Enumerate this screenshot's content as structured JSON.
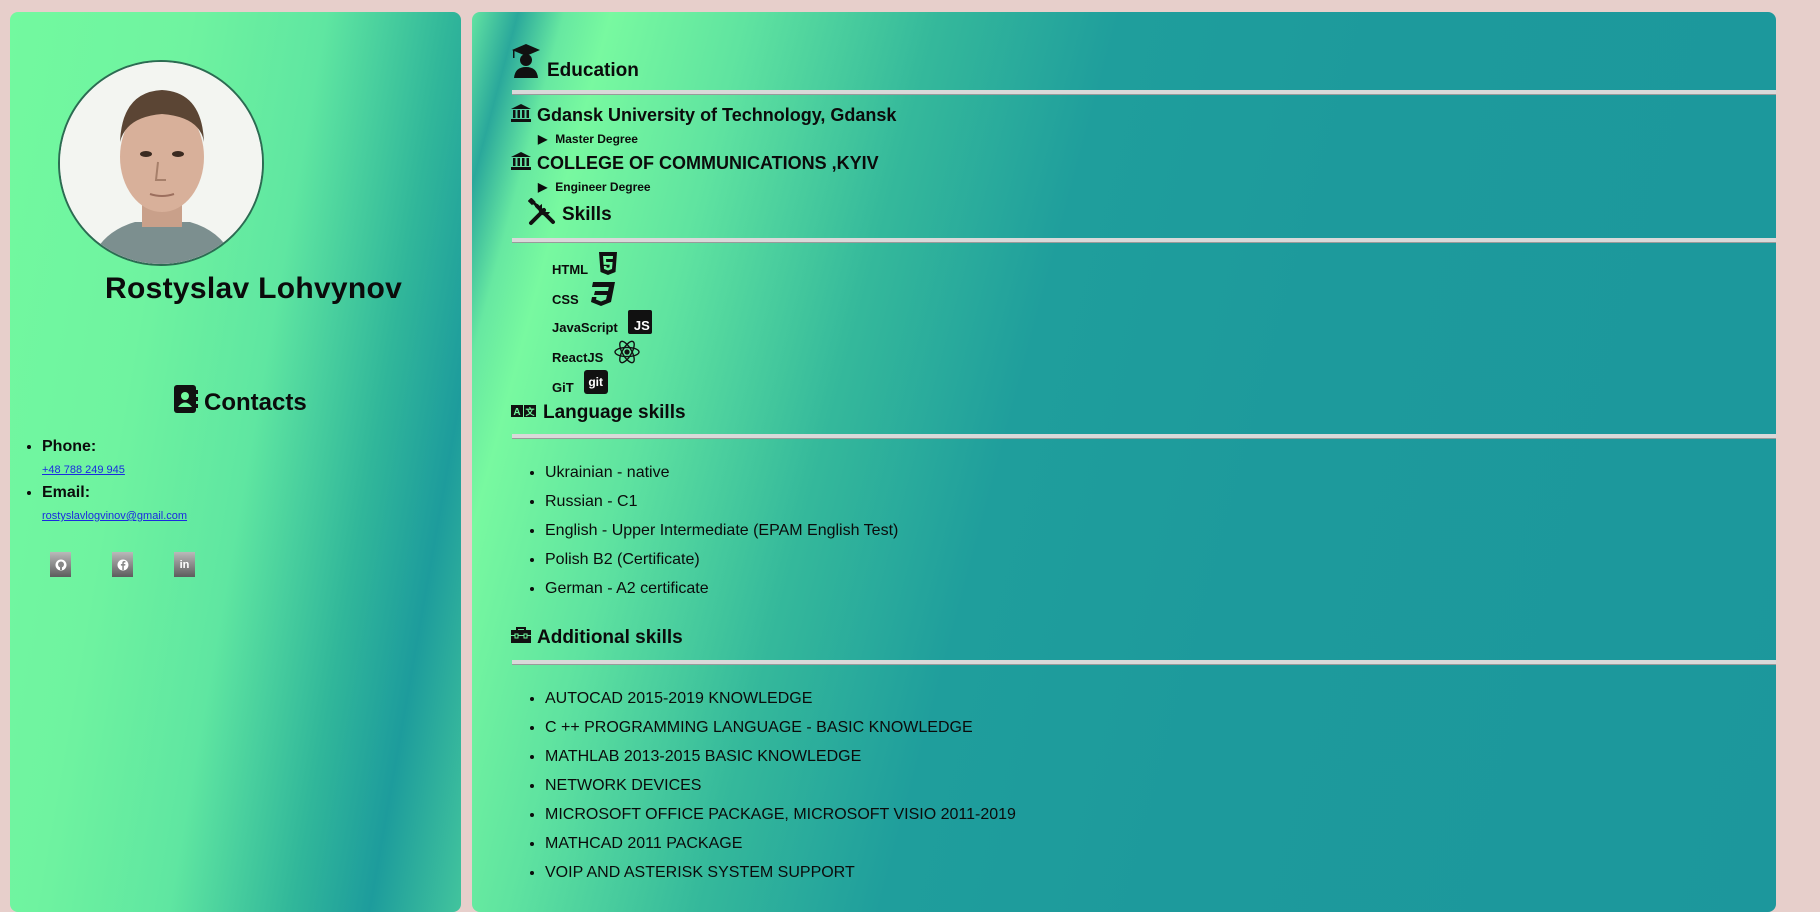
{
  "profile": {
    "name": "Rostyslav Lohvynov"
  },
  "contacts": {
    "heading": "Contacts",
    "phone_label": "Phone:",
    "phone_value": "+48 788 249 945",
    "email_label": "Email:",
    "email_value": "rostyslavlogvinov@gmail.com",
    "socials": [
      {
        "icon": "github-icon",
        "glyph": "⌥"
      },
      {
        "icon": "facebook-icon",
        "glyph": "f"
      },
      {
        "icon": "linkedin-icon",
        "glyph": "in"
      }
    ]
  },
  "education": {
    "heading": "Education",
    "schools": [
      {
        "name": "Gdansk University of Technology, Gdansk",
        "degree": "Master Degree"
      },
      {
        "name": "COLLEGE OF COMMUNICATIONS ,KYIV",
        "degree": "Engineer Degree"
      }
    ]
  },
  "skills": {
    "heading": "Skills",
    "items": [
      {
        "label": "HTML",
        "icon": "html5-icon"
      },
      {
        "label": "CSS",
        "icon": "css3-icon"
      },
      {
        "label": "JavaScript",
        "icon": "js-icon",
        "badge": "JS"
      },
      {
        "label": "ReactJS",
        "icon": "react-icon"
      },
      {
        "label": "GiT",
        "icon": "git-icon",
        "badge": "git"
      }
    ]
  },
  "languages": {
    "heading": "Language skills",
    "items": [
      "Ukrainian - native",
      "Russian - C1",
      "English - Upper Intermediate (EPAM English Test)",
      "Polish B2 (Certificate)",
      "German - A2 certificate"
    ]
  },
  "additional": {
    "heading": "Additional skills",
    "items": [
      "AUTOCAD 2015-2019 KNOWLEDGE",
      "C ++ PROGRAMMING LANGUAGE - BASIC KNOWLEDGE",
      "MATHLAB 2013-2015 BASIC KNOWLEDGE",
      "NETWORK DEVICES",
      "MICROSOFT OFFICE PACKAGE, MICROSOFT VISIO 2011-2019",
      "MATHCAD 2011 PACKAGE",
      "VOIP AND ASTERISK SYSTEM SUPPORT"
    ]
  },
  "colors": {
    "accent_green": "#72f99f",
    "accent_teal": "#1d9a9c",
    "page_bg": "#e7cfcb",
    "link": "#1a2be0"
  }
}
